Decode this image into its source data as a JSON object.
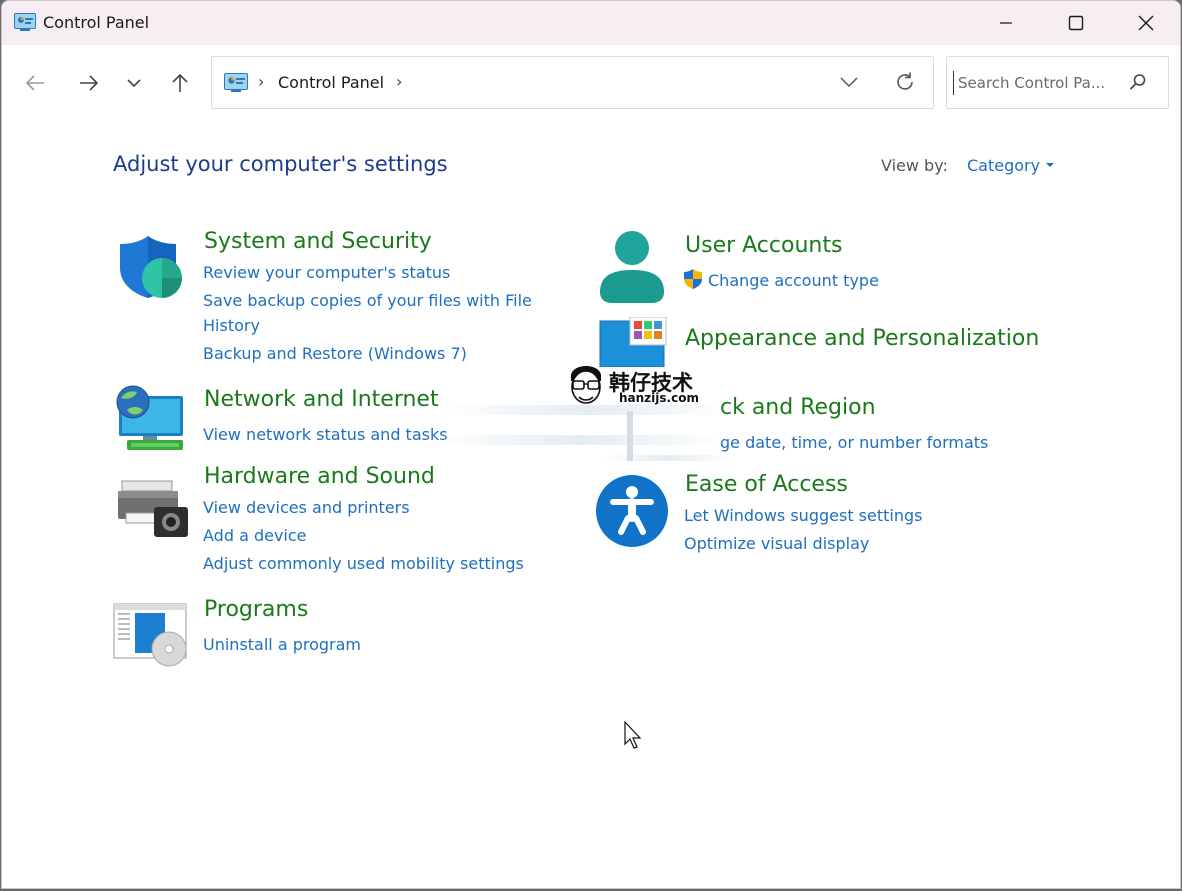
{
  "window": {
    "title": "Control Panel"
  },
  "address": {
    "crumb": "Control Panel",
    "separator": "›"
  },
  "search": {
    "placeholder": "Search Control Pa..."
  },
  "page": {
    "heading": "Adjust your computer's settings",
    "view_by_label": "View by:",
    "view_by_value": "Category"
  },
  "categories": {
    "system_security": {
      "title": "System and Security",
      "links": [
        "Review your computer's status",
        "Save backup copies of your files with File",
        "History",
        "Backup and Restore (Windows 7)"
      ]
    },
    "network": {
      "title": "Network and Internet",
      "links": [
        "View network status and tasks"
      ]
    },
    "hardware": {
      "title": "Hardware and Sound",
      "links": [
        "View devices and printers",
        "Add a device",
        "Adjust commonly used mobility settings"
      ]
    },
    "programs": {
      "title": "Programs",
      "links": [
        "Uninstall a program"
      ]
    },
    "user_accounts": {
      "title": "User Accounts",
      "links": [
        "Change account type"
      ]
    },
    "appearance": {
      "title": "Appearance and Personalization"
    },
    "clock_region": {
      "title": "ck and Region",
      "links": [
        "ge date, time, or number formats"
      ]
    },
    "ease": {
      "title": "Ease of Access",
      "links": [
        "Let Windows suggest settings",
        "Optimize visual display"
      ]
    }
  },
  "watermark": {
    "cn": "韩仔技术",
    "en": "hanzijs.com"
  },
  "colors": {
    "title_green": "#1a7a1a",
    "link_blue": "#1f6fbf",
    "heading_blue": "#1e3a8a",
    "titlebar": "#f7eef3"
  }
}
